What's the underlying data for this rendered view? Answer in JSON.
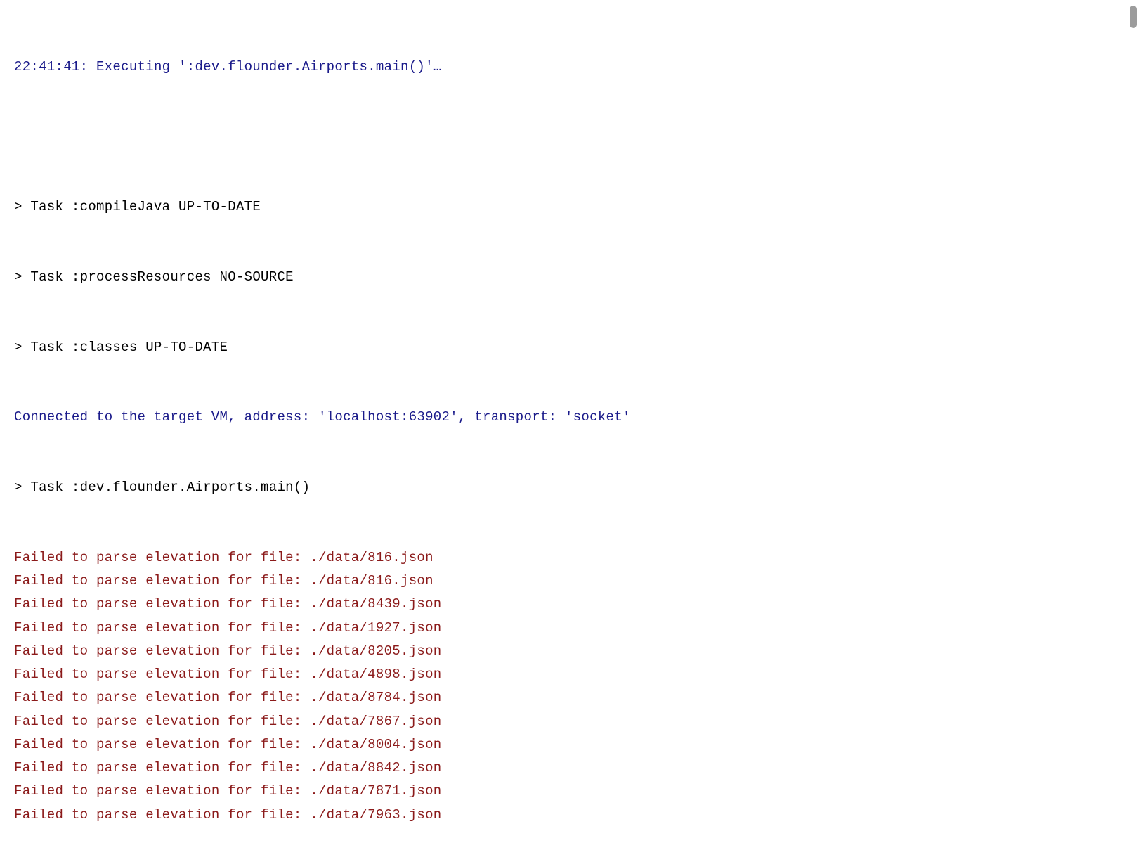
{
  "header": {
    "timestamp": "22:41:41",
    "executing_text": "Executing ':dev.flounder.Airports.main()'…"
  },
  "tasks": [
    "> Task :compileJava UP-TO-DATE",
    "> Task :processResources NO-SOURCE",
    "> Task :classes UP-TO-DATE"
  ],
  "connection": "Connected to the target VM, address: 'localhost:63902', transport: 'socket'",
  "main_task": "> Task :dev.flounder.Airports.main()",
  "error_prefix": "Failed to parse elevation for file: ",
  "error_files": [
    "./data/816.json",
    "./data/816.json",
    "./data/8439.json",
    "./data/1927.json",
    "./data/8205.json",
    "./data/4898.json",
    "./data/8784.json",
    "./data/7867.json",
    "./data/8004.json",
    "./data/8842.json",
    "./data/7871.json",
    "./data/7963.json"
  ]
}
